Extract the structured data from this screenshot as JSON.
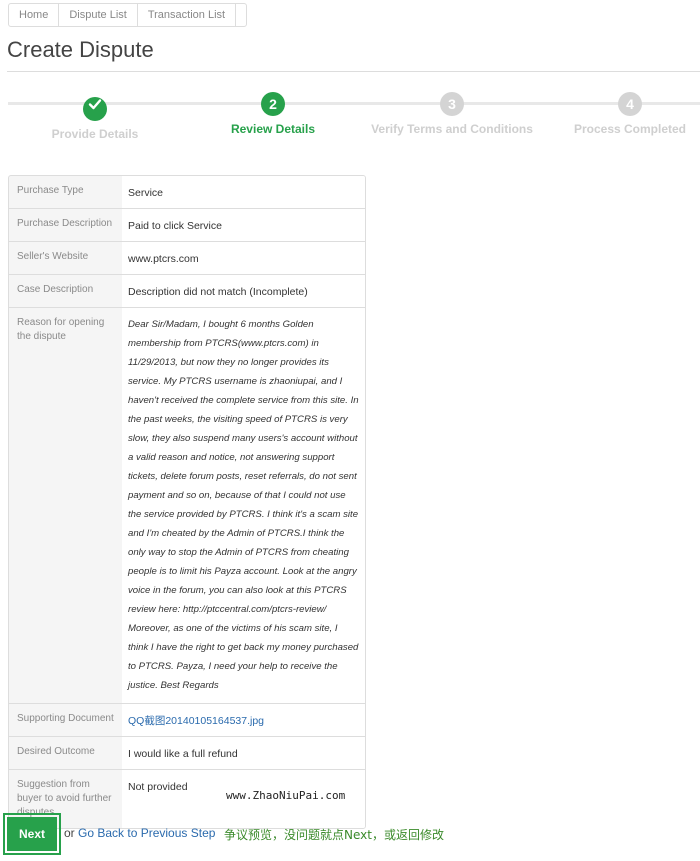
{
  "breadcrumb": [
    "Home",
    "Dispute List",
    "Transaction List"
  ],
  "page_title": "Create Dispute",
  "steps": [
    {
      "number": "",
      "label": "Provide Details",
      "state": "done",
      "icon": "check-icon"
    },
    {
      "number": "2",
      "label": "Review Details",
      "state": "active"
    },
    {
      "number": "3",
      "label": "Verify Terms and Conditions",
      "state": "pending"
    },
    {
      "number": "4",
      "label": "Process Completed",
      "state": "pending"
    }
  ],
  "details": {
    "purchase_type": {
      "label": "Purchase Type",
      "value": "Service"
    },
    "purchase_description": {
      "label": "Purchase Description",
      "value": "Paid to click Service"
    },
    "seller_website": {
      "label": "Seller's Website",
      "value": "www.ptcrs.com"
    },
    "case_description": {
      "label": "Case Description",
      "value": "Description did not match (Incomplete)"
    },
    "reason": {
      "label": "Reason for opening the dispute",
      "value": "Dear Sir/Madam, I bought 6 months Golden membership from PTCRS(www.ptcrs.com) in 11/29/2013, but now they no longer provides its service. My PTCRS username is zhaoniupai, and I haven't received the complete service from this site. In the past weeks, the visiting speed of PTCRS is very slow, they also suspend many users's account without a valid reason and notice, not answering support tickets, delete forum posts, reset referrals, do not sent payment and so on, because of that I could not use the service provided by PTCRS. I think it's a scam site and I'm cheated by the Admin of PTCRS.I think the only way to stop the Admin of PTCRS from cheating people is to limit his Payza account. Look at the angry voice in the forum, you can also look at this PTCRS review here: http://ptccentral.com/ptcrs-review/ Moreover, as one of the victims of his scam site, I think I have the right to get back my money purchased to PTCRS. Payza, I need your help to receive the justice. Best Regards"
    },
    "supporting_document": {
      "label": "Supporting Document",
      "value": "QQ截图20140105164537.jpg"
    },
    "desired_outcome": {
      "label": "Desired Outcome",
      "value": "I would like a full refund"
    },
    "suggestion": {
      "label": "Suggestion from buyer to avoid further disputes",
      "value": "Not provided"
    }
  },
  "watermark": "www.ZhaoNiuPai.com",
  "actions": {
    "next_label": "Next",
    "or_text": "or",
    "back_label": "Go Back to Previous Step"
  },
  "annotation": "争议预览，没问题就点Next，或返回修改",
  "colors": {
    "accent": "#27a14b",
    "link": "#2a6aad",
    "pending": "#d4d4d4"
  }
}
